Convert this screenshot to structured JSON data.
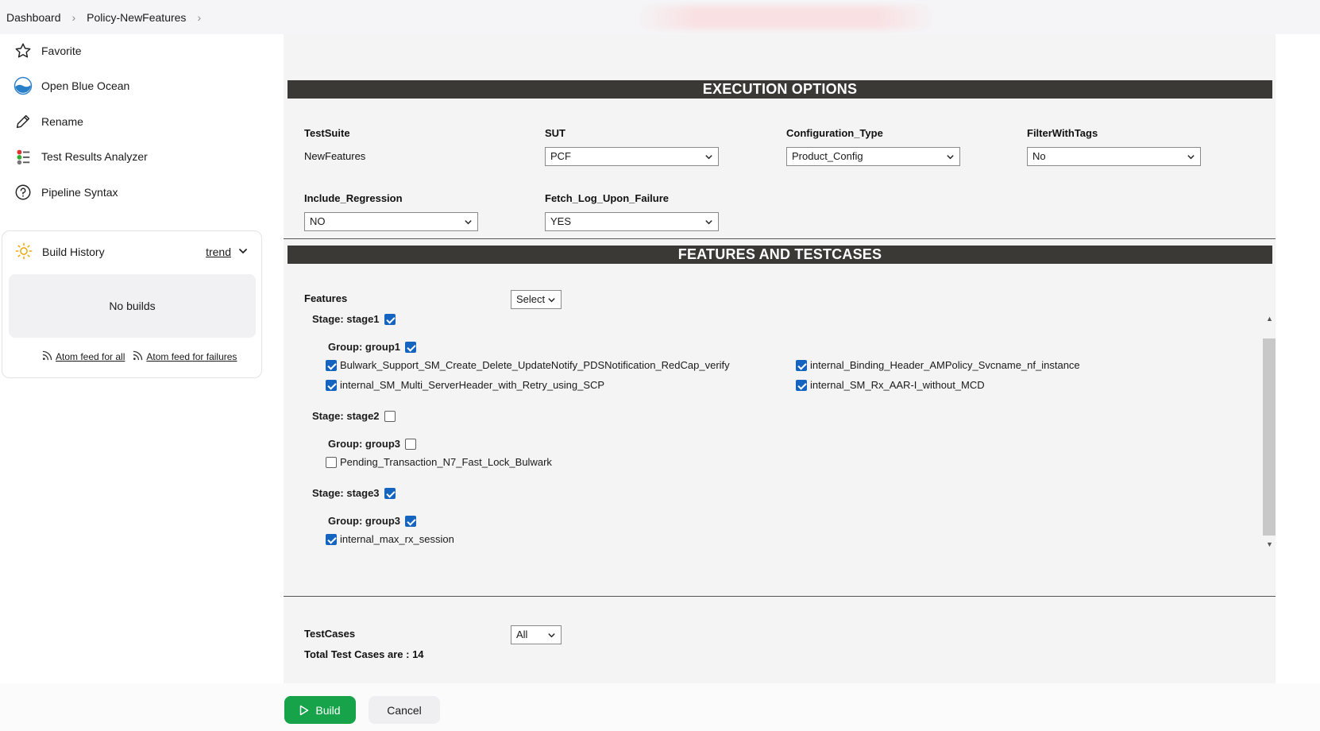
{
  "breadcrumb": {
    "items": [
      "Dashboard",
      "Policy-NewFeatures"
    ]
  },
  "sidebar": {
    "items": [
      {
        "label": "Favorite",
        "icon": "star-icon"
      },
      {
        "label": "Open Blue Ocean",
        "icon": "blue-ocean-icon"
      },
      {
        "label": "Rename",
        "icon": "pencil-icon"
      },
      {
        "label": "Test Results Analyzer",
        "icon": "analyzer-icon"
      },
      {
        "label": "Pipeline Syntax",
        "icon": "help-icon"
      }
    ]
  },
  "build_history": {
    "title": "Build History",
    "trend": "trend",
    "empty": "No builds",
    "feed_all": "Atom feed for all",
    "feed_failures": "Atom feed for failures"
  },
  "execution": {
    "header": "EXECUTION OPTIONS",
    "testsuite_label": "TestSuite",
    "testsuite_value": "NewFeatures",
    "sut_label": "SUT",
    "sut_value": "PCF",
    "config_label": "Configuration_Type",
    "config_value": "Product_Config",
    "filter_label": "FilterWithTags",
    "filter_value": "No",
    "regression_label": "Include_Regression",
    "regression_value": "NO",
    "fetchlog_label": "Fetch_Log_Upon_Failure",
    "fetchlog_value": "YES"
  },
  "features": {
    "header": "FEATURES AND TESTCASES",
    "label": "Features",
    "select_value": "Select",
    "stage1": "Stage: stage1",
    "group1": "Group: group1",
    "tc1": "Bulwark_Support_SM_Create_Delete_UpdateNotify_PDSNotification_RedCap_verify",
    "tc2": "internal_Binding_Header_AMPolicy_Svcname_nf_instance",
    "tc3": "internal_SM_Multi_ServerHeader_with_Retry_using_SCP",
    "tc4": "internal_SM_Rx_AAR-I_without_MCD",
    "stage2": "Stage: stage2",
    "group3a": "Group: group3",
    "tc5": "Pending_Transaction_N7_Fast_Lock_Bulwark",
    "stage3": "Stage: stage3",
    "group3b": "Group: group3",
    "tc6": "internal_max_rx_session"
  },
  "testcases": {
    "label": "TestCases",
    "select_value": "All",
    "total": "Total Test Cases are : 14"
  },
  "actions": {
    "build": "Build",
    "cancel": "Cancel"
  },
  "colors": {
    "section_bar": "#3a3935",
    "build_button": "#16a34a",
    "checkbox": "#1565c0"
  }
}
